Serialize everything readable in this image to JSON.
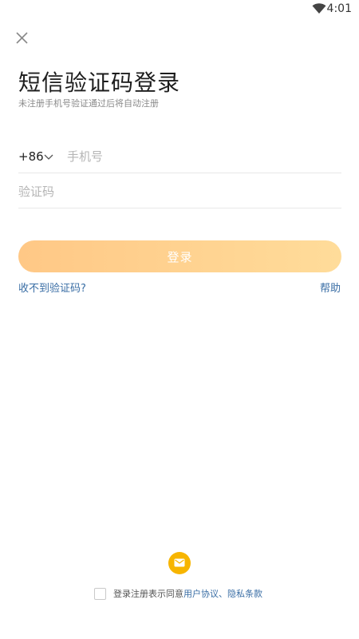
{
  "status_bar": {
    "time": "4:01",
    "wifi_icon": "wifi-icon"
  },
  "close_icon": "close-icon",
  "title": "短信验证码登录",
  "subtitle": "未注册手机号验证通过后将自动注册",
  "phone": {
    "country_code": "+86",
    "placeholder": "手机号",
    "value": ""
  },
  "code": {
    "placeholder": "验证码",
    "value": ""
  },
  "login_button": "登录",
  "links": {
    "no_code": "收不到验证码?",
    "help": "帮助"
  },
  "alt_login_icon": "mail-icon",
  "agreement": {
    "prefix": "登录注册表示同意",
    "user_agreement": "用户协议",
    "separator": "、",
    "privacy": "隐私条款"
  },
  "colors": {
    "button_gradient_start": "#ffc886",
    "button_gradient_end": "#ffdc9a",
    "link": "#3a6ea5",
    "mail_circle": "#f7b500"
  }
}
